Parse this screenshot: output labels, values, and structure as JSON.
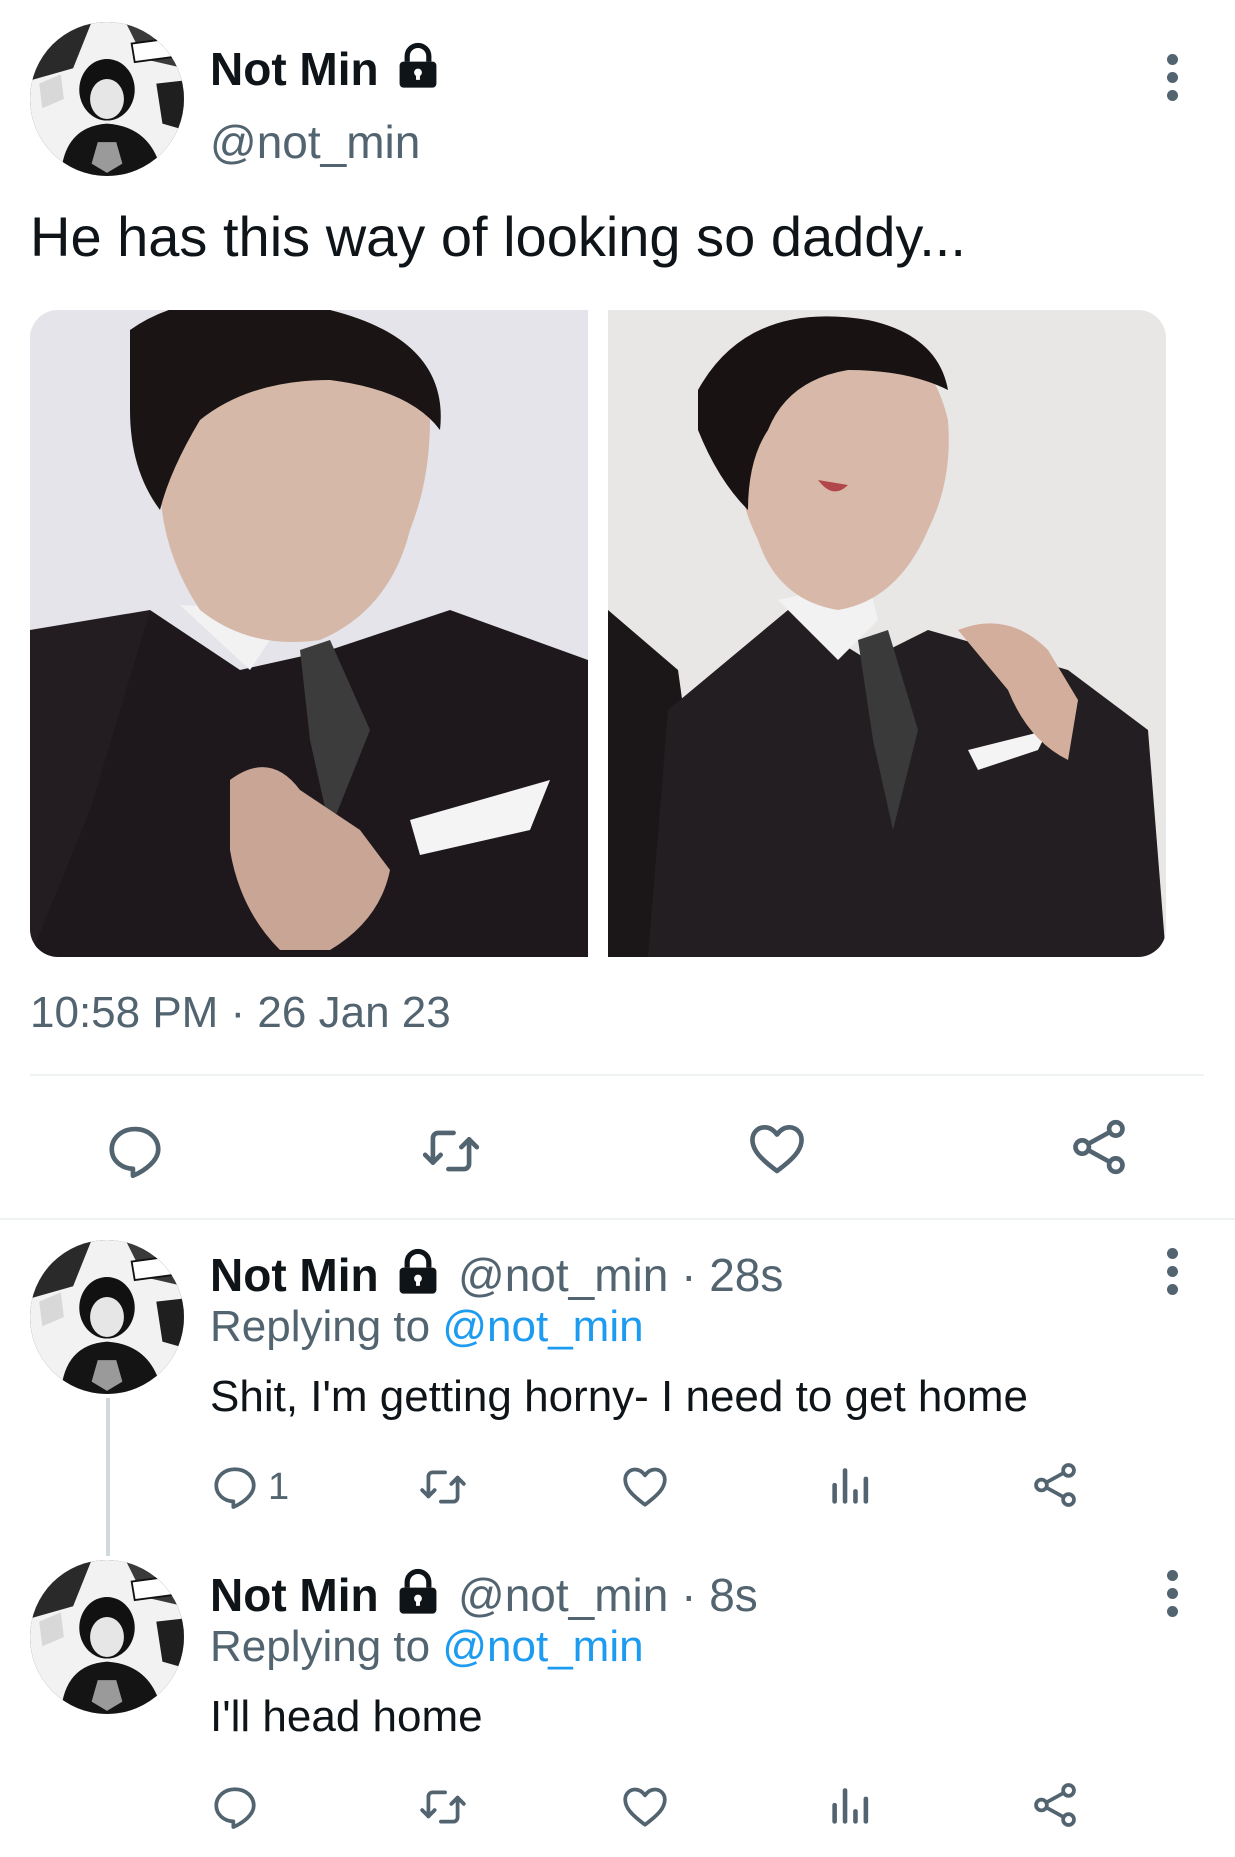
{
  "main_tweet": {
    "name": "Not Min",
    "handle": "@not_min",
    "text": "He has this way of looking so daddy...",
    "timestamp": "10:58 PM · 26 Jan 23"
  },
  "replies": [
    {
      "name": "Not Min",
      "handle_time": "@not_min · 28s",
      "replying_prefix": "Replying to ",
      "replying_mention": "@not_min",
      "text": "Shit, I'm getting horny- I need to get home",
      "reply_count": "1"
    },
    {
      "name": "Not Min",
      "handle_time": "@not_min · 8s",
      "replying_prefix": "Replying to ",
      "replying_mention": "@not_min",
      "text": "I'll head home",
      "reply_count": ""
    }
  ],
  "icons": {
    "lock": "lock-icon",
    "more": "more-options-icon",
    "reply": "reply-icon",
    "retweet": "retweet-icon",
    "like": "heart-icon",
    "share": "share-icon",
    "views": "views-icon"
  },
  "colors": {
    "text": "#0f1419",
    "secondary": "#536471",
    "link": "#1d9bf0",
    "divider": "#eff3f4"
  }
}
